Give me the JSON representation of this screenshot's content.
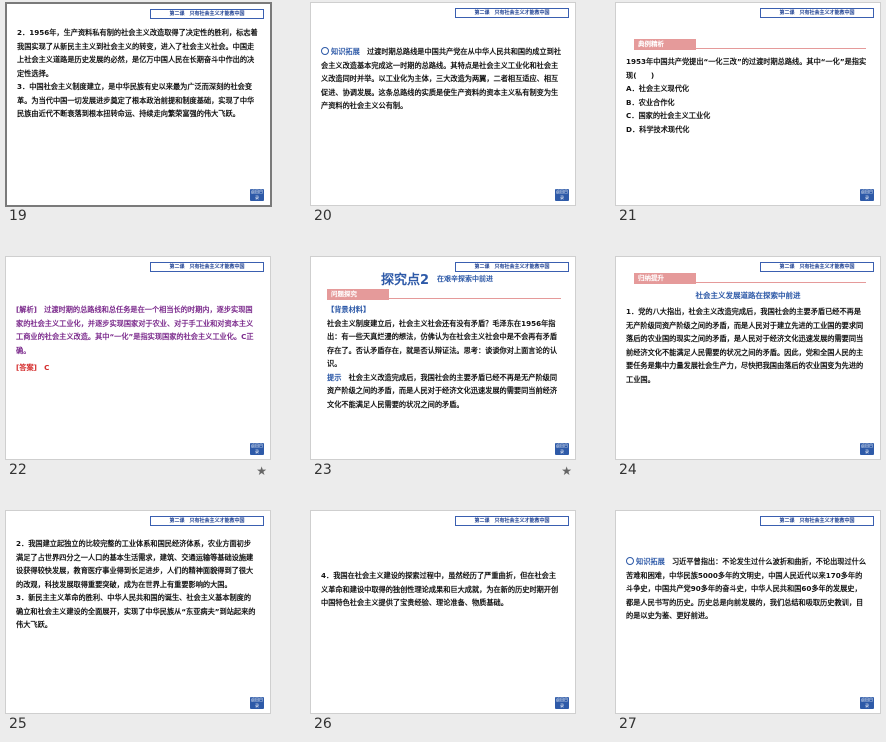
{
  "header_text": "第二课　只有社会主义才能救中国",
  "nav_label": "返回目录",
  "slides": [
    {
      "num": "19",
      "star": false,
      "selected": true,
      "text": "2．1956年，生产资料私有制的社会主义改造取得了决定性的胜利，标志着我国实现了从新民主主义到社会主义的转变，进入了社会主义社会。中国走上社会主义道路是历史发展的必然，是亿万中国人民在长期奋斗中作出的决定性选择。\n3．中国社会主义制度建立，是中华民族有史以来最为广泛而深刻的社会变革。为当代中国一切发展进步奠定了根本政治前提和制度基础，实现了中华民族由近代不断衰落到根本扭转命运、持续走向繁荣富强的伟大飞跃。"
    },
    {
      "num": "20",
      "star": false,
      "lead": "知识拓展",
      "text": "过渡时期总路线是中国共产党在从中华人民共和国的成立到社会主义改造基本完成这一时期的总路线。其特点是社会主义工业化和社会主义改造同时并举。以工业化为主体，三大改造为两翼，二者相互适应、相互促进、协调发展。这条总路线的实质是使生产资料的资本主义私有制变为生产资料的社会主义公有制。"
    },
    {
      "num": "21",
      "star": false,
      "banner": "典例精析",
      "question": "1953年中国共产党提出“一化三改”的过渡时期总路线。其中“一化”是指实现(　　)",
      "options": [
        "A．社会主义现代化",
        "B．农业合作化",
        "C．国家的社会主义工业化",
        "D．科学技术现代化"
      ]
    },
    {
      "num": "22",
      "star": true,
      "analysis_tag": "[解析]",
      "analysis": "过渡时期的总路线和总任务是在一个相当长的时期内，逐步实现国家的社会主义工业化，并逐步实现国家对于农业、对于手工业和对资本主义工商业的社会主义改造。其中“一化”是指实现国家的社会主义工业化。C正确。",
      "answer_tag": "[答案]",
      "answer": "C"
    },
    {
      "num": "23",
      "star": true,
      "title": "探究点2",
      "subtitle": "在艰辛探索中前进",
      "banner": "问题探究",
      "material_tag": "【背景材料】",
      "material": "社会主义制度建立后，社会主义社会还有没有矛盾？毛泽东在1956年指出：有一些天真烂漫的想法，仿佛认为在社会主义社会中是不会再有矛盾存在了。否认矛盾存在，就是否认辩证法。思考：谈谈你对上面言论的认识。",
      "hint_tag": "提示",
      "hint": "社会主义改造完成后，我国社会的主要矛盾已经不再是无产阶级同资产阶级之间的矛盾，而是人民对于经济文化迅速发展的需要同当前经济文化不能满足人民需要的状况之间的矛盾。"
    },
    {
      "num": "24",
      "star": false,
      "banner": "归纳提升",
      "heading": "社会主义发展道路在探索中前进",
      "text": "1．党的八大指出，社会主义改造完成后，我国社会的主要矛盾已经不再是无产阶级同资产阶级之间的矛盾，而是人民对于建立先进的工业国的要求同落后的农业国的现实之间的矛盾，是人民对于经济文化迅速发展的需要同当前经济文化不能满足人民需要的状况之间的矛盾。因此，党和全国人民的主要任务是集中力量发展社会生产力，尽快把我国由落后的农业国变为先进的工业国。"
    },
    {
      "num": "25",
      "star": false,
      "text": "2．我国建立起独立的比较完整的工业体系和国民经济体系，农业方面初步满足了占世界四分之一人口的基本生活需求，建筑、交通运输等基础设施建设获得较快发展，教育医疗事业得到长足进步，人们的精神面貌得到了很大的改观，科技发展取得重要突破，成为在世界上有重要影响的大国。\n3．新民主主义革命的胜利、中华人民共和国的诞生、社会主义基本制度的确立和社会主义建设的全面展开，实现了中华民族从“东亚病夫”到站起来的伟大飞跃。"
    },
    {
      "num": "26",
      "star": false,
      "text": "4．我国在社会主义建设的探索过程中，虽然经历了严重曲折，但在社会主义革命和建设中取得的独创性理论成果和巨大成就，为在新的历史时期开创中国特色社会主义提供了宝贵经验、理论准备、物质基础。"
    },
    {
      "num": "27",
      "star": false,
      "lead": "知识拓展",
      "text": "习近平曾指出：不论发生过什么波折和曲折，不论出现过什么苦难和困难，中华民族5000多年的文明史，中国人民近代以来170多年的斗争史，中国共产党90多年的奋斗史，中华人民共和国60多年的发展史，都是人民书写的历史。历史总是向前发展的，我们总结和吸取历史教训，目的是以史为鉴、更好前进。"
    }
  ]
}
